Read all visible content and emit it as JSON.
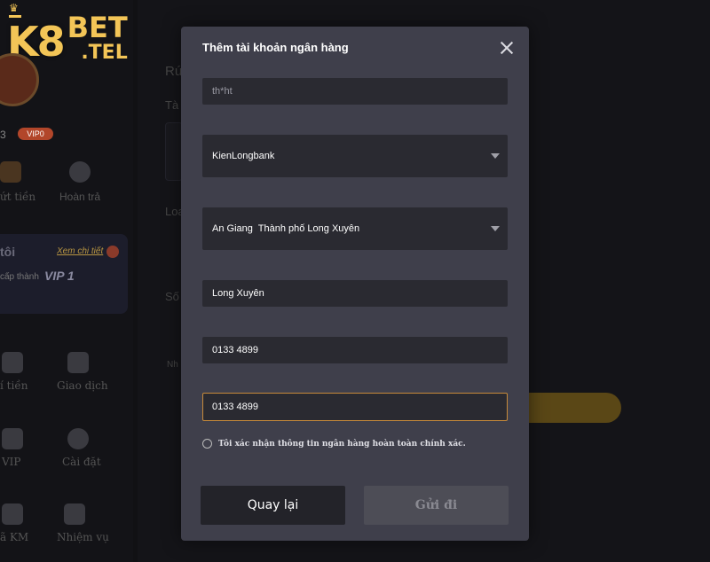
{
  "brand": {
    "logo_main": "K8",
    "logo_bet": "BET",
    "logo_tel": ".TEL"
  },
  "background": {
    "user_id_fragment": "3",
    "vip_badge": "VIP0",
    "quick_actions": [
      "ứt tiền",
      "Hoàn trả"
    ],
    "promo": {
      "title": "tôi",
      "link": "Xem chi tiết",
      "subtitle": "cấp thành",
      "vip": "VIP 1"
    },
    "menu": [
      "í tiền",
      "Giao dịch",
      "VIP",
      "Cài đặt",
      "ã KM",
      "Nhiệm vụ"
    ],
    "main_fragments": [
      "Rú",
      "Tà",
      "Loa",
      "Số",
      "Nh"
    ]
  },
  "modal": {
    "title": "Thêm tài khoản ngân hàng",
    "name_field": {
      "placeholder": "th*ht"
    },
    "bank_select": {
      "value": "KienLongbank"
    },
    "province_select": {
      "value": "An Giang  Thành phố Long Xuyên"
    },
    "branch_field": {
      "value": "Long Xuyên"
    },
    "account_field": {
      "value": "0133 4899"
    },
    "account_confirm_field": {
      "value": "0133 4899"
    },
    "confirm_text": "Tôi xác nhận thông tin ngân hàng hoàn toàn chính xác.",
    "back_label": "Quay lại",
    "submit_label": "Gửi đi"
  },
  "colors": {
    "accent": "#f3c557",
    "modal_bg": "#3f3f4b",
    "field_bg": "#2a2a31",
    "active_border": "#c78a3a"
  }
}
